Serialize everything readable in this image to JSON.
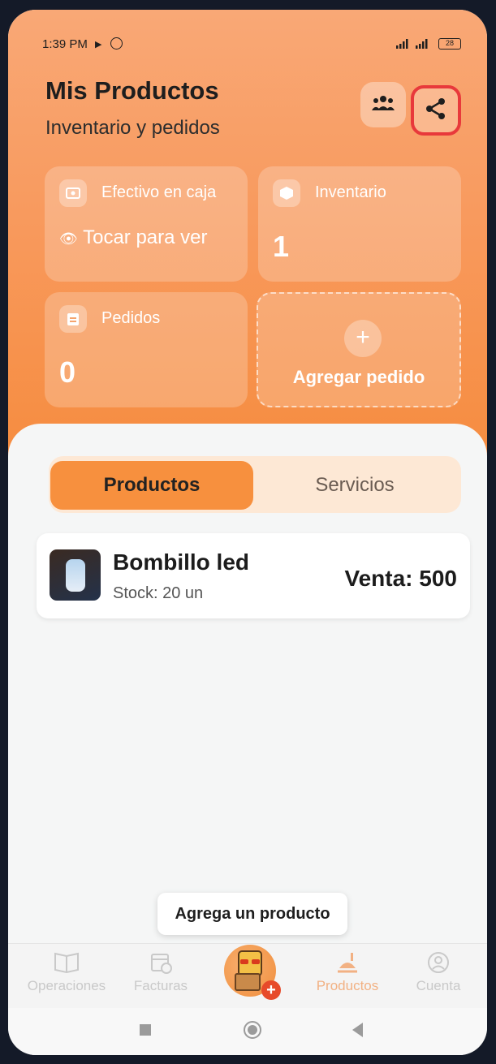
{
  "status_bar": {
    "time": "1:39 PM",
    "battery": "28"
  },
  "header": {
    "title": "Mis Productos",
    "subtitle": "Inventario y pedidos"
  },
  "cards": {
    "cash": {
      "label": "Efectivo en caja",
      "hint": "Tocar para ver"
    },
    "inventory": {
      "label": "Inventario",
      "value": "1"
    },
    "orders": {
      "label": "Pedidos",
      "value": "0"
    },
    "add_order": {
      "label": "Agregar pedido"
    }
  },
  "tabs": [
    {
      "label": "Productos",
      "active": true
    },
    {
      "label": "Servicios",
      "active": false
    }
  ],
  "products": [
    {
      "name": "Bombillo led",
      "stock": "Stock: 20 un",
      "price": "Venta: 500"
    }
  ],
  "tooltip": "Agrega un producto",
  "bottom_nav": [
    {
      "label": "Operaciones",
      "icon": "book-icon"
    },
    {
      "label": "Facturas",
      "icon": "calendar-clock-icon"
    },
    {
      "label": "",
      "icon": "mascot-add-icon"
    },
    {
      "label": "Productos",
      "icon": "food-tray-icon"
    },
    {
      "label": "Cuenta",
      "icon": "account-icon"
    }
  ],
  "colors": {
    "header_orange": "#f68c3f",
    "accent": "#f7903e",
    "highlight_border": "#e8393b"
  }
}
